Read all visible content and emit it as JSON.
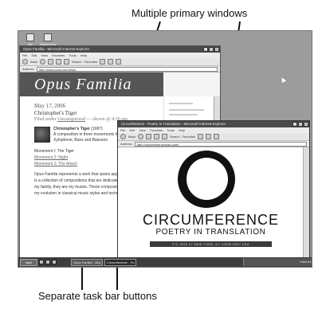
{
  "callouts": {
    "top": "Multiple primary windows",
    "bottom": "Separate task bar buttons"
  },
  "desktop": {
    "icons": [
      {
        "label": "My Documents"
      },
      {
        "label": "Assignment Documents"
      }
    ]
  },
  "window_opus": {
    "title": "Opus Familia - Microsoft Internet Explorer",
    "menu": [
      "File",
      "Edit",
      "View",
      "Favorites",
      "Tools",
      "Help"
    ],
    "toolbar": {
      "back": "Back",
      "search": "Search",
      "favorites": "Favorites"
    },
    "address_label": "Address",
    "address": "http://www.opus.com/blog/",
    "banner": "Opus Familia",
    "post_date": "May 17, 2006",
    "post_title": "Christopher's Tiger",
    "filed_prefix": "Filed under",
    "filed_category": "Uncategorized",
    "filed_suffix": "— shown @ 4:36 pm",
    "tiger_name": "Christopher's Tiger",
    "tiger_year": "(1987)",
    "tiger_desc": "A composition in three movements for Flutes, Vibraphone, Xylophone, Bass and Bassoon",
    "movement_1": "Movement I: The Tiger",
    "movement_2": "Movement 2: Night",
    "movement_3": "Movement 3: The Attack",
    "para": "Opus Familia represents a work that spans approximately 17 years. It is a collection of compositions that are dedicated to each member of my family, they are my muses. These compositions also represent my evolution in classical music styles and techniques."
  },
  "window_circ": {
    "title": "Circumference - Poetry In Translation - Microsoft Internet Explorer",
    "menu": [
      "File",
      "Edit",
      "View",
      "Favorites",
      "Tools",
      "Help"
    ],
    "toolbar": {
      "back": "Back",
      "search": "Search",
      "favorites": "Favorites"
    },
    "address_label": "Address",
    "address": "http://circumferencemag.com/",
    "brand": "CIRCUMFERENCE",
    "tagline": "POETRY IN TRANSLATION",
    "address_bar": "P.O. BOX 27 NEW YORK, NY 10039-9527 USA"
  },
  "taskbar": {
    "start": "start",
    "tasks": [
      {
        "label": "Opus Familia - Micr..."
      },
      {
        "label": "Circumference - Po..."
      }
    ],
    "tray": "Internet"
  }
}
